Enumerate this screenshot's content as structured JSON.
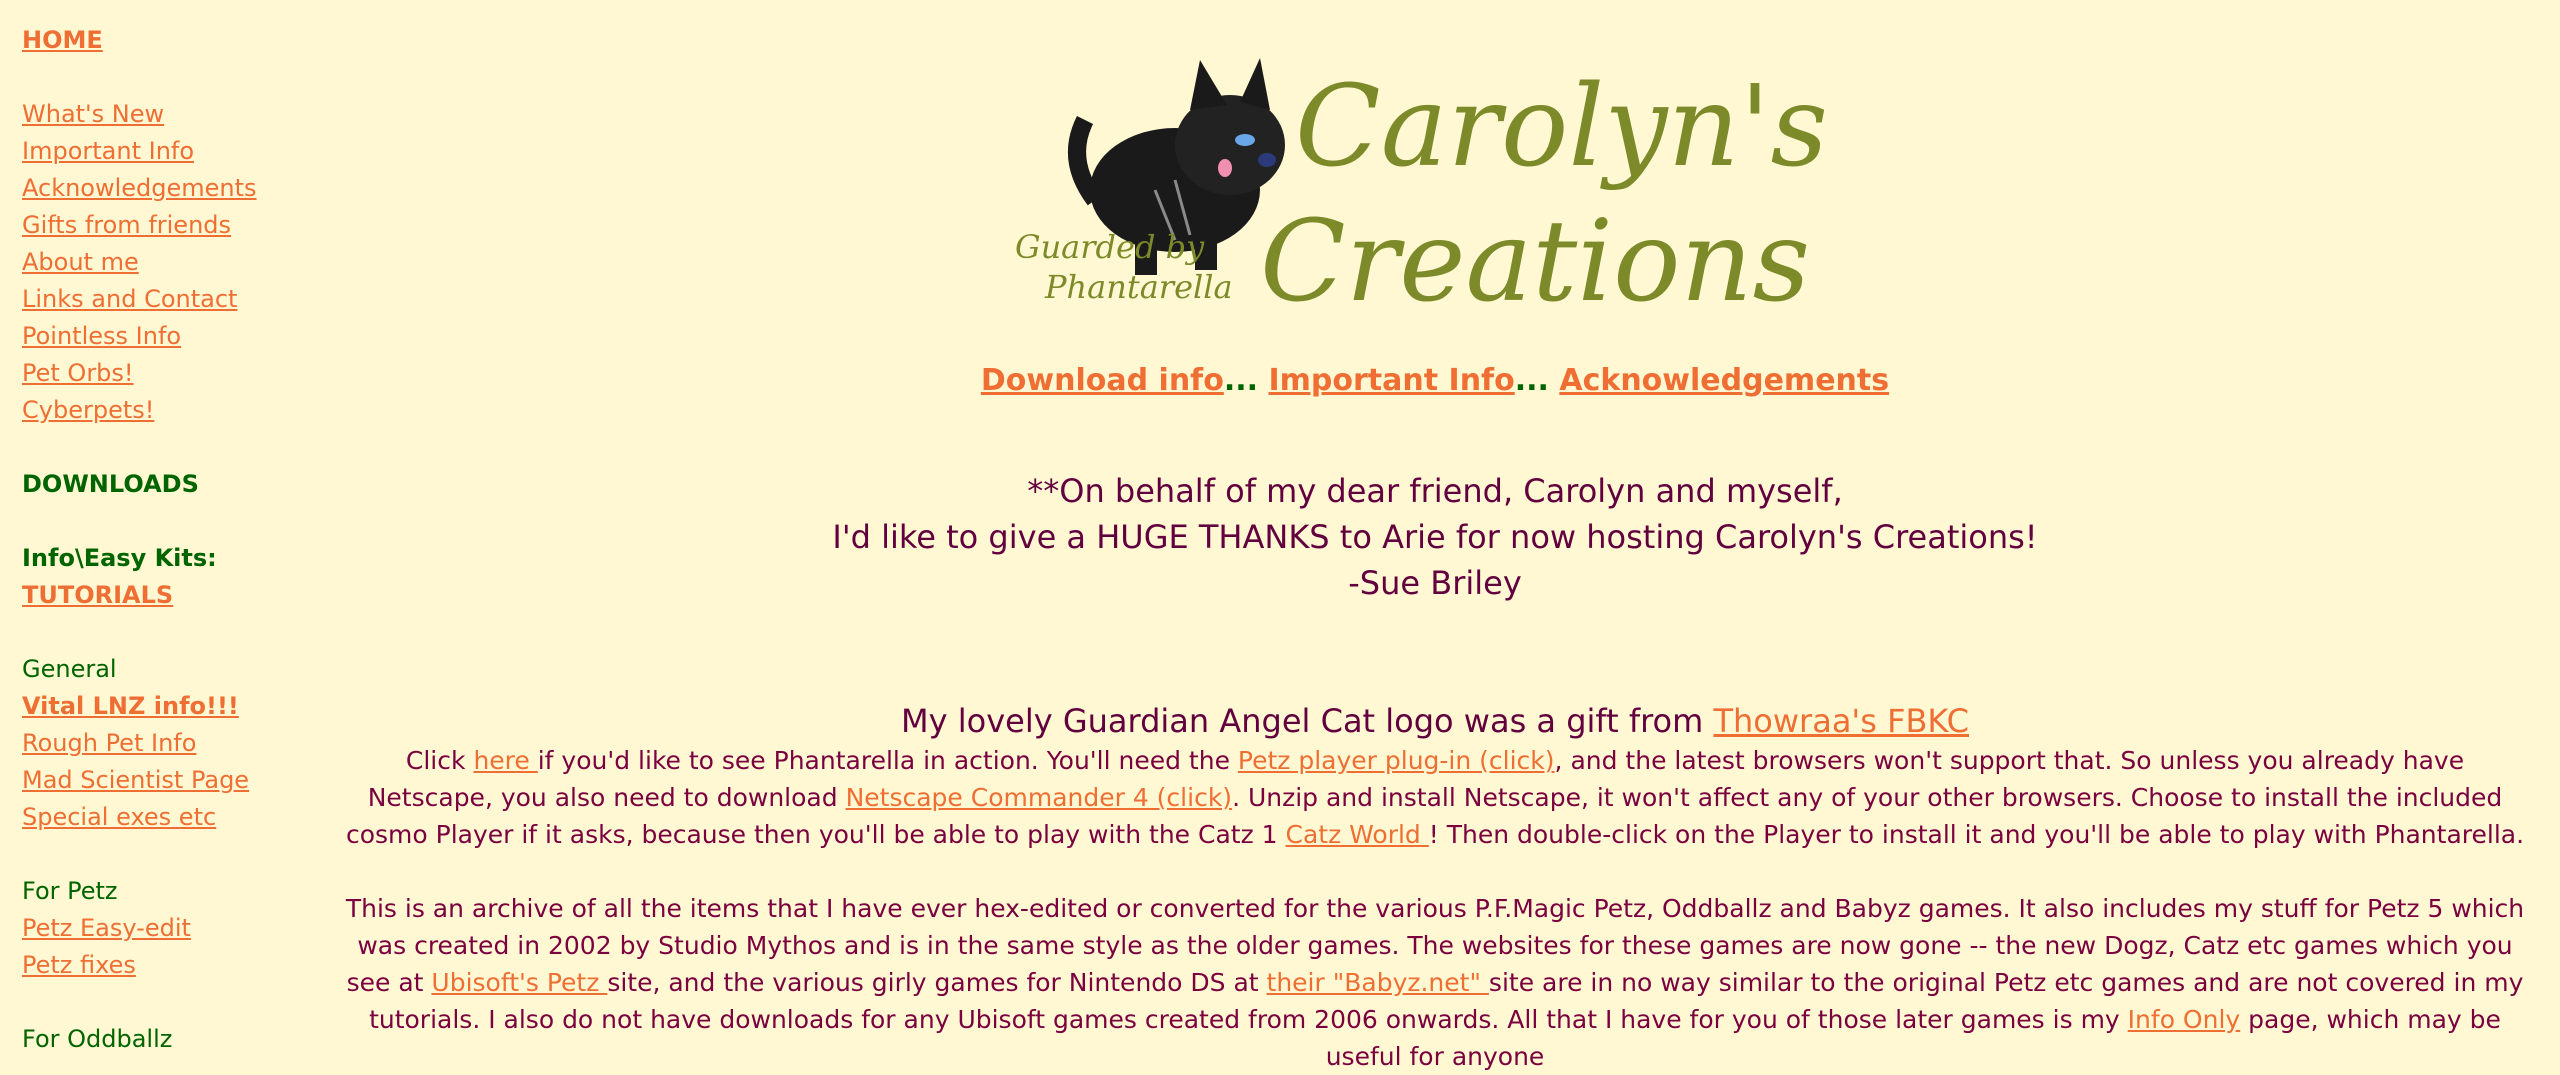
{
  "sidebar": {
    "home": "HOME",
    "links1": [
      "What's New",
      "Important Info",
      "Acknowledgements",
      "Gifts from friends",
      "About me",
      "Links and Contact",
      "Pointless Info",
      "Pet Orbs!",
      "Cyberpets!"
    ],
    "downloads_heading": "DOWNLOADS",
    "info_kits_heading": "Info\\Easy Kits:",
    "tutorials": "TUTORIALS",
    "general_heading": "General",
    "general_links": [
      "Vital LNZ info!!!",
      "Rough Pet Info",
      "Mad Scientist Page",
      "Special exes etc"
    ],
    "petz_heading": "For Petz",
    "petz_links": [
      "Petz Easy-edit",
      "Petz fixes"
    ],
    "oddballz_heading": "For Oddballz"
  },
  "logo": {
    "title_line1": "Carolyn's",
    "title_line2": "Creations",
    "guard_line1": "Guarded by",
    "guard_line2": "Phantarella"
  },
  "top_links": {
    "download": "Download info",
    "sep1": "...",
    "important": "Important Info",
    "sep2": "...",
    "ack": "Acknowledgements"
  },
  "dedication": {
    "line1": "**On behalf of my dear friend, Carolyn and myself,",
    "line2": "I'd like to give a HUGE THANKS to Arie for now hosting Carolyn's Creations!",
    "line3": "-Sue Briley"
  },
  "logo_credit": {
    "text": "My lovely Guardian Angel Cat logo was a gift from ",
    "link": "Thowraa's FBKC"
  },
  "para1": {
    "t1": "Click ",
    "l1": "here ",
    "t2": "if you'd like to see Phantarella in action. You'll need the ",
    "l2": "Petz player plug-in (click)",
    "t3": ", and the latest browsers won't support that. So unless you already have Netscape, you also need to download ",
    "l3": "Netscape Commander 4 (click)",
    "t4": ". Unzip and install Netscape, it won't affect any of your other browsers. Choose to install the included cosmo Player if it asks, because then you'll be able to play with the Catz 1 ",
    "l4": "Catz World ",
    "t5": "! Then double-click on the Player to install it and you'll be able to play with Phantarella."
  },
  "para2": {
    "t1": "This is an archive of all the items that I have ever hex-edited or converted for the various P.F.Magic Petz, Oddballz and Babyz games. It also includes my stuff for Petz 5 which was created in 2002 by Studio Mythos and is in the same style as the older games. The websites for these games are now gone -- the new Dogz, Catz etc games which you see at ",
    "l1": "Ubisoft's Petz ",
    "t2": "site, and the various girly games for Nintendo DS at ",
    "l2": "their \"Babyz.net\" ",
    "t3": "site are in no way similar to the original Petz etc games and are not covered in my tutorials. I also do not have downloads for any Ubisoft games created from 2006 onwards. All that I have for you of those later games is my ",
    "l3": "Info Only",
    "t4": " page, which may be useful for anyone"
  },
  "colors": {
    "background": "#fff8d2",
    "link": "#ef6e34",
    "heading_green": "#006400",
    "body_text": "#7a0040",
    "logo_olive": "#7d8a2a"
  }
}
